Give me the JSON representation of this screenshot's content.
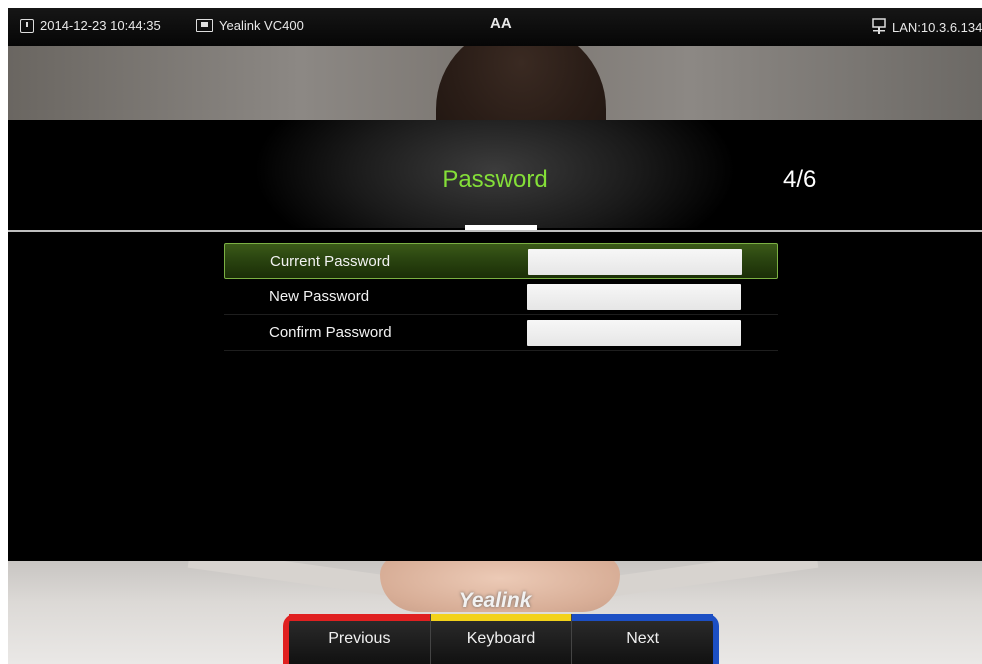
{
  "status_bar": {
    "datetime": "2014-12-23 10:44:35",
    "device": "Yealink VC400",
    "font_indicator": "AA",
    "network": "LAN:10.3.6.134"
  },
  "header": {
    "title": "Password",
    "page_counter": "4/6"
  },
  "form": {
    "rows": [
      {
        "label": "Current Password",
        "value": ""
      },
      {
        "label": "New Password",
        "value": ""
      },
      {
        "label": "Confirm Password",
        "value": ""
      }
    ]
  },
  "watermark": "Yealink",
  "softkeys": [
    {
      "label": "Previous",
      "color": "#e02020"
    },
    {
      "label": "Keyboard",
      "color": "#f3d21a"
    },
    {
      "label": "Next",
      "color": "#1c4fc4"
    }
  ],
  "colors": {
    "title_green": "#84df38",
    "selected_row": "#2a4410"
  },
  "icons": {
    "datetime": "clock-icon",
    "device": "monitor-icon",
    "network": "network-icon"
  }
}
